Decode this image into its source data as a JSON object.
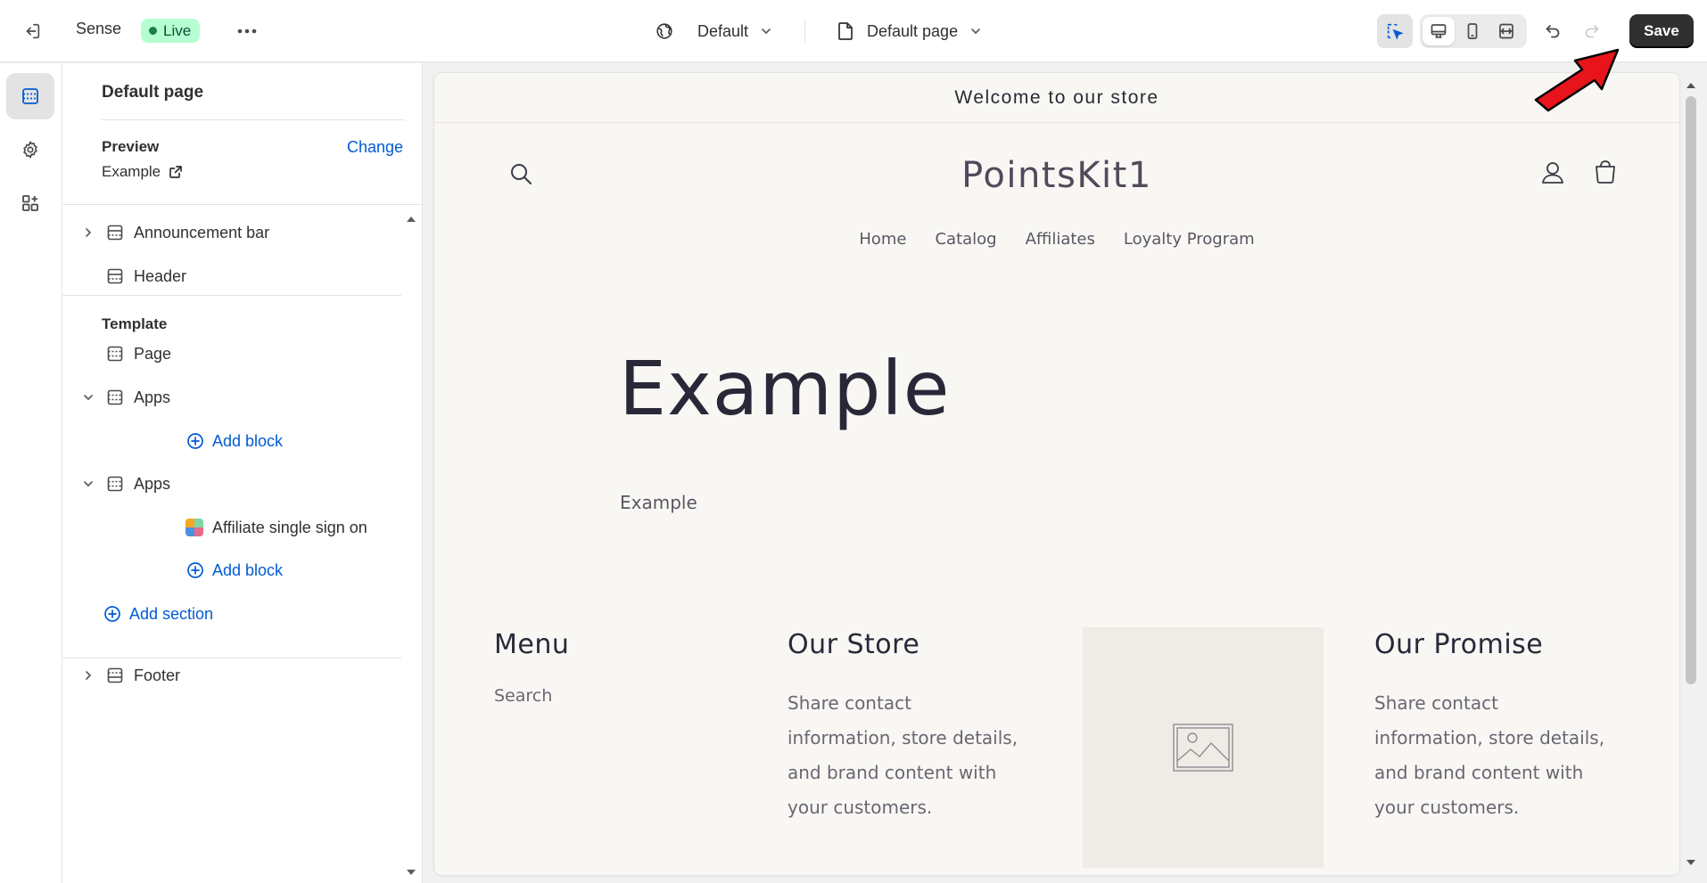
{
  "topbar": {
    "theme_name": "Sense",
    "live_badge": "Live",
    "country_selector": "Default",
    "page_selector": "Default page",
    "save_label": "Save"
  },
  "sidebar": {
    "title": "Default page",
    "preview_label": "Preview",
    "change_label": "Change",
    "preview_value": "Example",
    "header_group": {
      "items": [
        {
          "label": "Announcement bar"
        },
        {
          "label": "Header"
        }
      ]
    },
    "template_group": {
      "label": "Template",
      "page_item": "Page",
      "apps1": {
        "label": "Apps",
        "add_block": "Add block"
      },
      "apps2": {
        "label": "Apps",
        "block": "Affiliate single sign on",
        "add_block": "Add block"
      },
      "add_section": "Add section"
    },
    "footer_group": {
      "label": "Footer"
    }
  },
  "preview": {
    "announcement": "Welcome to our store",
    "logo": "PointsKit1",
    "nav": [
      "Home",
      "Catalog",
      "Affiliates",
      "Loyalty Program"
    ],
    "page_title": "Example",
    "page_body": "Example",
    "footer": {
      "menu": {
        "title": "Menu",
        "link": "Search"
      },
      "store": {
        "title": "Our Store",
        "lines": [
          "Share contact",
          "information, store details,",
          "and brand content with",
          "your customers."
        ]
      },
      "promise": {
        "title": "Our Promise",
        "lines": [
          "Share contact",
          "information, store details,",
          "and brand content with",
          "your customers."
        ]
      }
    }
  },
  "colors": {
    "accent": "#005bd3",
    "live_bg": "#b4fed2",
    "save_bg": "#303030",
    "preview_bg": "#f9f7f4",
    "annotation_arrow": "#e8141c"
  }
}
